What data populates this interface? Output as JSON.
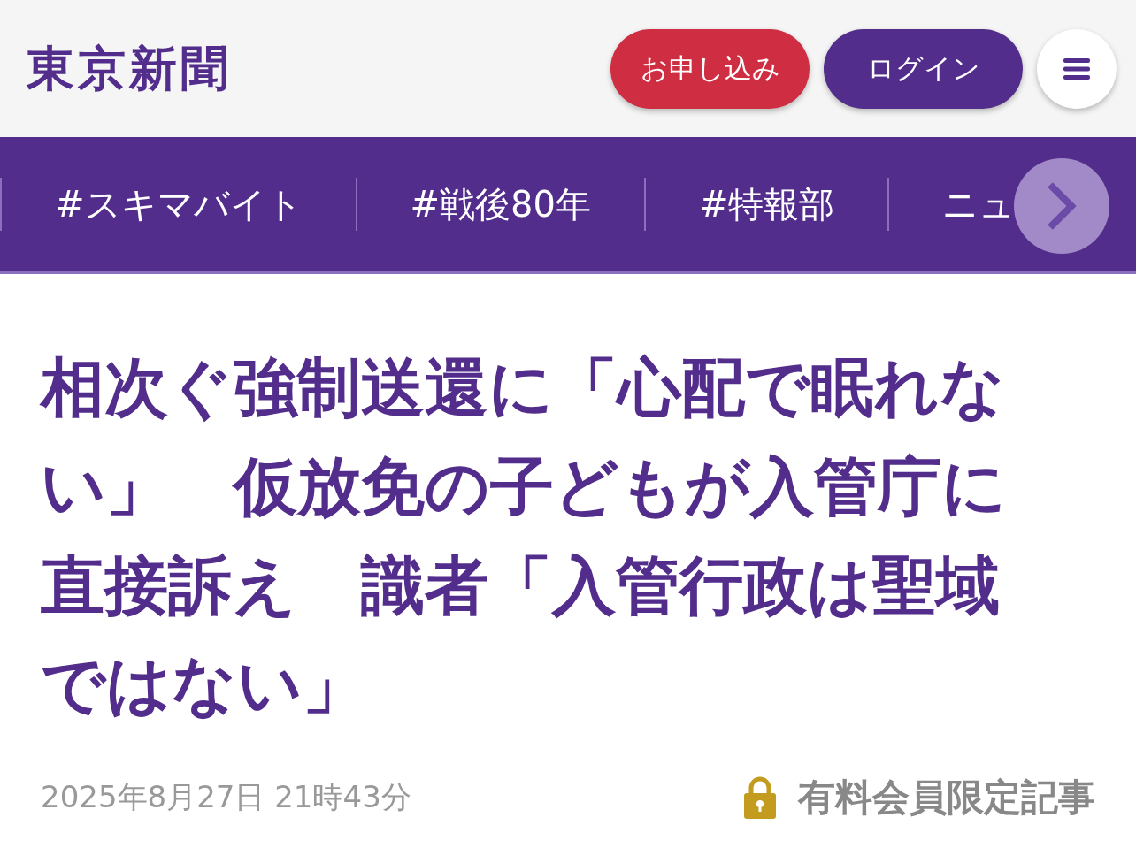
{
  "header": {
    "logo": "東京新聞",
    "buttons": [
      {
        "label": "お申し込み",
        "kind": "subscribe"
      },
      {
        "label": "ログイン",
        "kind": "login"
      }
    ],
    "menu": {
      "kind": "menu"
    }
  },
  "nav": {
    "items": [
      {
        "label": "#スキマバイト"
      },
      {
        "label": "#戦後80年"
      },
      {
        "label": "#特報部"
      },
      {
        "label": "ニュ"
      }
    ],
    "scroll_next": true
  },
  "article": {
    "title": "相次ぐ強制送還に「心配で眠れない」　仮放免の子どもが入管庁に直接訴え　識者「入管行政は聖域ではない」",
    "date": "2025年8月27日 21時43分",
    "paywall": {
      "locked": true,
      "label": "有料会員限定記事"
    }
  }
}
